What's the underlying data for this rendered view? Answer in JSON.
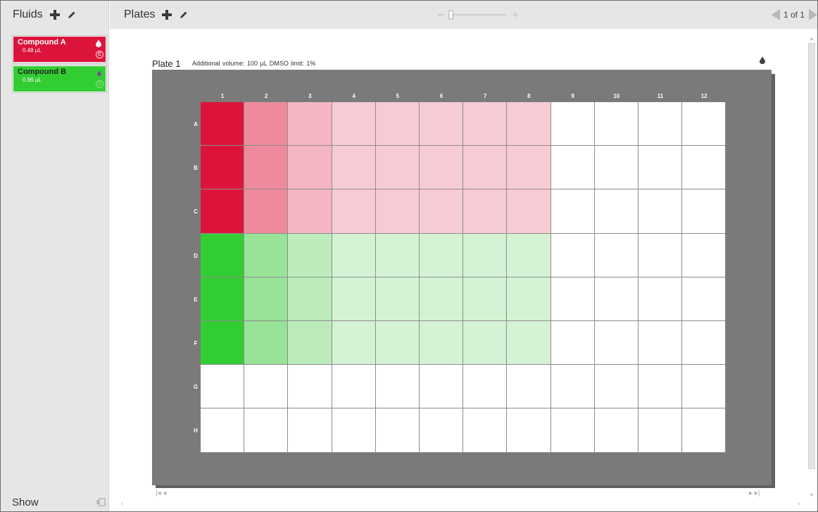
{
  "fluids_panel": {
    "title": "Fluids",
    "items": [
      {
        "name": "Compound A",
        "volume": "0.48 µL",
        "color": "#dc143c",
        "c_mark": "C"
      },
      {
        "name": "Compound B",
        "volume": "0.96 µL",
        "color": "#32cd32",
        "c_mark": "C"
      }
    ],
    "show_label": "Show"
  },
  "plates_panel": {
    "title": "Plates",
    "pager": {
      "text": "1 of 1"
    }
  },
  "plate": {
    "title": "Plate 1",
    "info": "Additional volume: 100 µL   DMSO limit: 1%",
    "columns": [
      "1",
      "2",
      "3",
      "4",
      "5",
      "6",
      "7",
      "8",
      "9",
      "10",
      "11",
      "12"
    ],
    "rows": [
      "A",
      "B",
      "C",
      "D",
      "E",
      "F",
      "G",
      "H"
    ],
    "wells": [
      [
        "#dc143c",
        "#ed8b9d",
        "#f4b6c3",
        "#f7cbd4",
        "#f7cbd4",
        "#f7cbd4",
        "#f7cbd4",
        "#f7cbd4",
        "#ffffff",
        "#ffffff",
        "#ffffff",
        "#ffffff"
      ],
      [
        "#dc143c",
        "#ed8b9d",
        "#f4b6c3",
        "#f7cbd4",
        "#f7cbd4",
        "#f7cbd4",
        "#f7cbd4",
        "#f7cbd4",
        "#ffffff",
        "#ffffff",
        "#ffffff",
        "#ffffff"
      ],
      [
        "#dc143c",
        "#ed8b9d",
        "#f4b6c3",
        "#f7cbd4",
        "#f7cbd4",
        "#f7cbd4",
        "#f7cbd4",
        "#f7cbd4",
        "#ffffff",
        "#ffffff",
        "#ffffff",
        "#ffffff"
      ],
      [
        "#32cd32",
        "#98e398",
        "#bcecbc",
        "#d4f3d4",
        "#d4f3d4",
        "#d4f3d4",
        "#d4f3d4",
        "#d4f3d4",
        "#ffffff",
        "#ffffff",
        "#ffffff",
        "#ffffff"
      ],
      [
        "#32cd32",
        "#98e398",
        "#bcecbc",
        "#d4f3d4",
        "#d4f3d4",
        "#d4f3d4",
        "#d4f3d4",
        "#d4f3d4",
        "#ffffff",
        "#ffffff",
        "#ffffff",
        "#ffffff"
      ],
      [
        "#32cd32",
        "#98e398",
        "#bcecbc",
        "#d4f3d4",
        "#d4f3d4",
        "#d4f3d4",
        "#d4f3d4",
        "#d4f3d4",
        "#ffffff",
        "#ffffff",
        "#ffffff",
        "#ffffff"
      ],
      [
        "#ffffff",
        "#ffffff",
        "#ffffff",
        "#ffffff",
        "#ffffff",
        "#ffffff",
        "#ffffff",
        "#ffffff",
        "#ffffff",
        "#ffffff",
        "#ffffff",
        "#ffffff"
      ],
      [
        "#ffffff",
        "#ffffff",
        "#ffffff",
        "#ffffff",
        "#ffffff",
        "#ffffff",
        "#ffffff",
        "#ffffff",
        "#ffffff",
        "#ffffff",
        "#ffffff",
        "#ffffff"
      ]
    ]
  },
  "icons": {
    "add": "plus-icon",
    "edit": "pencil-icon",
    "drop": "drop-icon",
    "prev": "triangle-left-icon",
    "next": "triangle-right-icon"
  }
}
